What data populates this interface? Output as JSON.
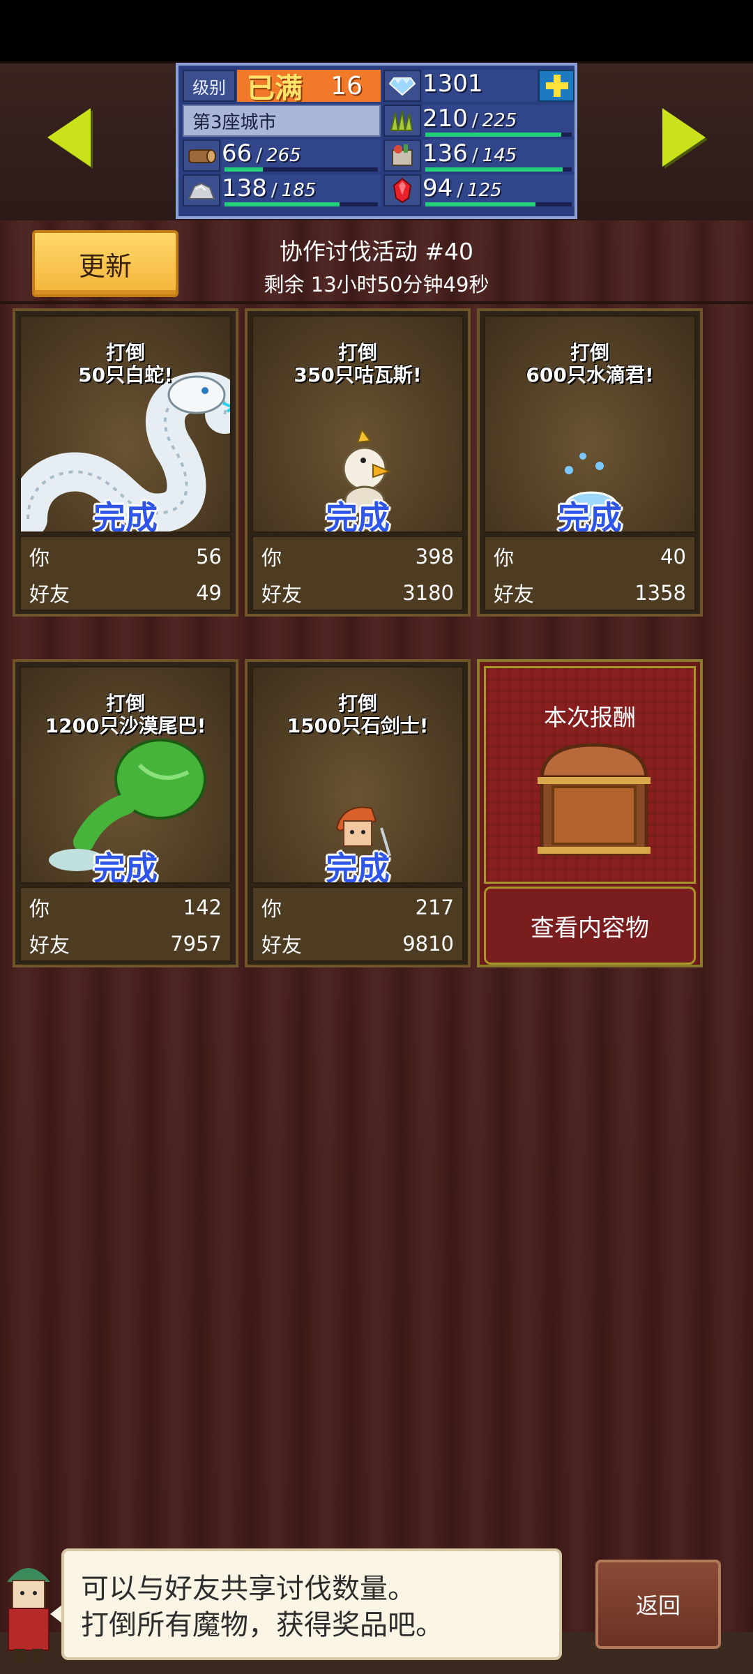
{
  "top_bar": {
    "level_label": "级别",
    "level_status": "已满",
    "level_value": "16",
    "gems": "1301",
    "city_name": "第3座城市",
    "resources": [
      {
        "icon": "grass-icon",
        "value": "210",
        "max": "225",
        "fill": 0.93
      },
      {
        "icon": "wood-icon",
        "value": "66",
        "max": "265",
        "fill": 0.25
      },
      {
        "icon": "food-icon",
        "value": "136",
        "max": "145",
        "fill": 0.94
      },
      {
        "icon": "ore-icon",
        "value": "138",
        "max": "185",
        "fill": 0.75
      },
      {
        "icon": "crystal-icon",
        "value": "94",
        "max": "125",
        "fill": 0.75
      }
    ],
    "colors": {
      "panel": "#2a3d7e",
      "accent": "#f07a2a",
      "bar": "#22d07a"
    }
  },
  "header": {
    "update_label": "更新",
    "event_title": "协作讨伐活动 #40",
    "timer": "剩余 13小时50分钟49秒"
  },
  "cards": [
    {
      "line1": "打倒",
      "line2": "50只白蛇!",
      "status": "完成",
      "you_label": "你",
      "you": "56",
      "friend_label": "好友",
      "friend": "49",
      "icon": "white-snake-icon"
    },
    {
      "line1": "打倒",
      "line2": "350只咕瓦斯!",
      "status": "完成",
      "you_label": "你",
      "you": "398",
      "friend_label": "好友",
      "friend": "3180",
      "icon": "chick-monster-icon"
    },
    {
      "line1": "打倒",
      "line2": "600只水滴君!",
      "status": "完成",
      "you_label": "你",
      "you": "40",
      "friend_label": "好友",
      "friend": "1358",
      "icon": "water-drop-icon"
    },
    {
      "line1": "打倒",
      "line2": "1200只沙漠尾巴!",
      "status": "完成",
      "you_label": "你",
      "you": "142",
      "friend_label": "好友",
      "friend": "7957",
      "icon": "desert-tail-icon"
    },
    {
      "line1": "打倒",
      "line2": "1500只石剑士!",
      "status": "完成",
      "you_label": "你",
      "you": "217",
      "friend_label": "好友",
      "friend": "9810",
      "icon": "stone-swordsman-icon"
    }
  ],
  "reward": {
    "title": "本次报酬",
    "button": "查看内容物"
  },
  "message": {
    "line1": "可以与好友共享讨伐数量。",
    "line2": "打倒所有魔物，获得奖品吧。"
  },
  "back_label": "返回"
}
